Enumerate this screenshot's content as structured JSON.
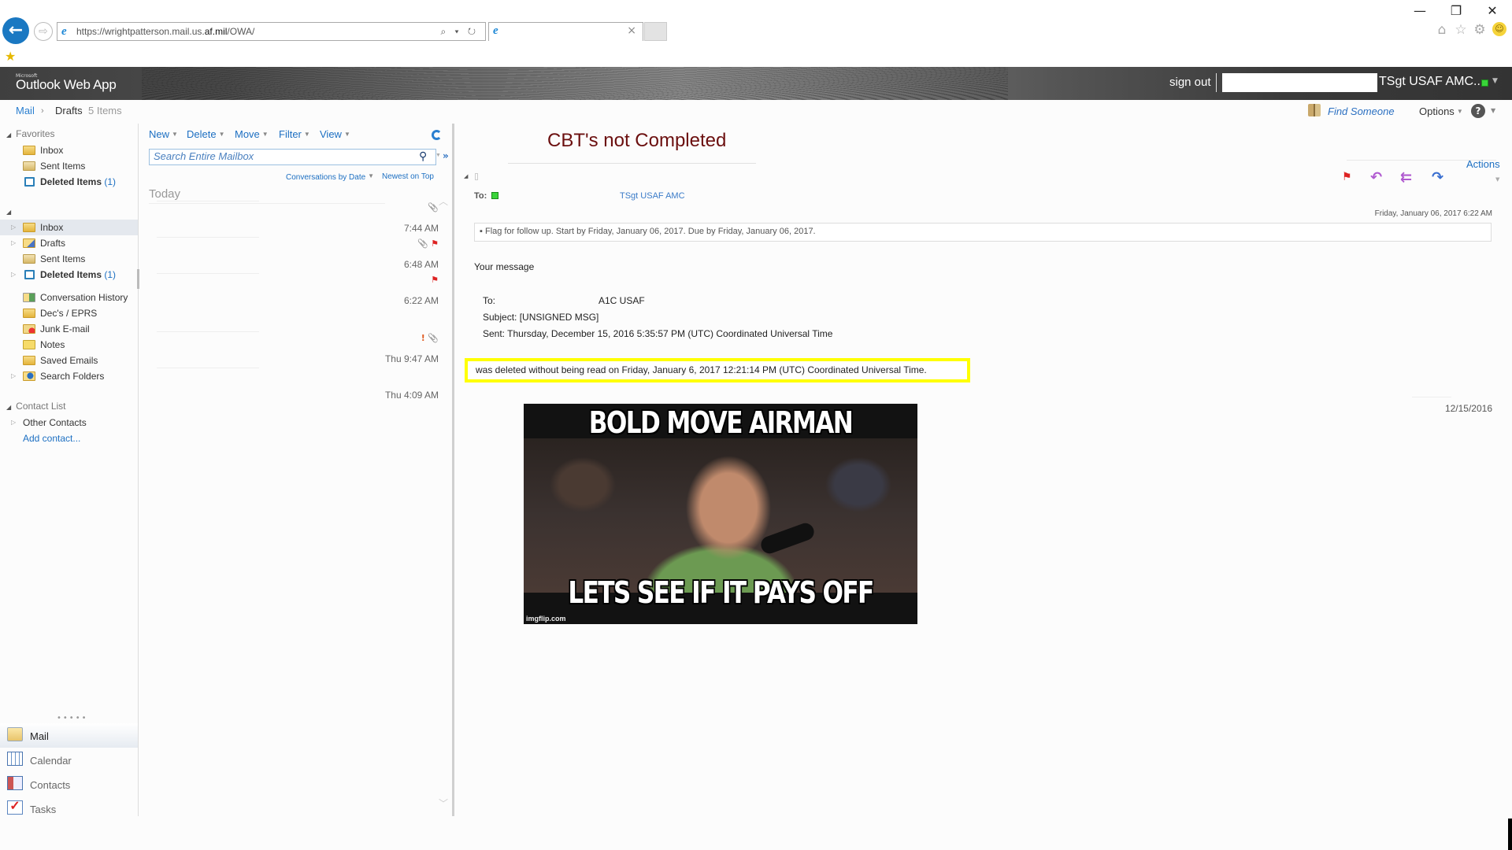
{
  "browser": {
    "url_prefix": "https://wrightpatterson.mail.us.",
    "url_domain": "af.mil",
    "url_suffix": "/OWA/",
    "tab_close": "×",
    "back_glyph": "←",
    "forward_glyph": "⇨",
    "addr_tools": "⌕ ▾ ↻",
    "window_controls": {
      "minimize": "—",
      "restore": "❐",
      "close": "✕"
    },
    "toolbar_icons": {
      "home": "⌂",
      "favorites": "☆",
      "settings": "⚙",
      "feedback": "☺"
    },
    "fav_bar_icon": "★"
  },
  "owa": {
    "brand_small": "Microsoft",
    "brand": "Outlook Web App",
    "sign_out": "sign out",
    "user": "TSgt USAF AMC...",
    "presence_color": "#3ad43a"
  },
  "breadcrumb": {
    "root": "Mail",
    "sep": "›",
    "folder": "Drafts",
    "count": "5 Items"
  },
  "topright": {
    "find_someone": "Find Someone",
    "options": "Options",
    "help": "?"
  },
  "folders": {
    "favorites_label": "Favorites",
    "favorites": [
      {
        "label": "Inbox",
        "icon": "inbox-icon"
      },
      {
        "label": "Sent Items",
        "icon": "sent-items-icon"
      },
      {
        "label": "Deleted Items",
        "count": "(1)",
        "icon": "deleted-items-icon"
      }
    ],
    "mailbox": [
      {
        "label": "Inbox",
        "expandable": true,
        "selected": true
      },
      {
        "label": "Drafts",
        "expandable": true
      },
      {
        "label": "Sent Items",
        "expandable": false
      },
      {
        "label": "Deleted Items",
        "count": "(1)",
        "expandable": true
      },
      {
        "label": "Conversation History"
      },
      {
        "label": "Dec's / EPRS"
      },
      {
        "label": "Junk E-mail"
      },
      {
        "label": "Notes"
      },
      {
        "label": "Saved Emails"
      },
      {
        "label": "Search Folders",
        "expandable": true
      }
    ],
    "contact_list_label": "Contact List",
    "other_contacts": "Other Contacts",
    "add_contact": "Add contact...",
    "grip": "•••••"
  },
  "nav": [
    {
      "label": "Mail",
      "selected": true
    },
    {
      "label": "Calendar"
    },
    {
      "label": "Contacts"
    },
    {
      "label": "Tasks"
    }
  ],
  "list": {
    "toolbar": [
      "New",
      "Delete",
      "Move",
      "Filter",
      "View"
    ],
    "search_placeholder": "Search Entire Mailbox",
    "sort_by": "Conversations by Date",
    "sort_order": "Newest on Top",
    "group_today": "Today",
    "messages": [
      {
        "time": "7:44 AM",
        "attachment": true,
        "flag": false,
        "important": false
      },
      {
        "time": "6:48 AM",
        "attachment": true,
        "flag": true,
        "important": false
      },
      {
        "time": "6:22 AM",
        "attachment": false,
        "flag": true,
        "important": false
      },
      {
        "time": "Thu 9:47 AM",
        "attachment": true,
        "flag": false,
        "important": true
      },
      {
        "time": "Thu 4:09 AM",
        "attachment": false,
        "flag": false,
        "important": false
      }
    ]
  },
  "reading": {
    "subject": "CBT's not Completed",
    "actions": "Actions",
    "to_label": "To:",
    "to_name": "TSgt USAF AMC",
    "received": "Friday, January 06, 2017 6:22 AM",
    "flag_info": "Flag for follow up. Start by Friday, January 06, 2017. Due by Friday, January 06, 2017.",
    "body": {
      "intro": "Your message",
      "to_label": "To:",
      "to_value": "A1C USAF",
      "subject_line": "Subject: [UNSIGNED MSG]",
      "sent_line": "Sent: Thursday, December 15, 2016 5:35:57 PM (UTC) Coordinated Universal Time",
      "deleted_line": "was deleted without being read on Friday, January 6, 2017 12:21:14 PM (UTC) Coordinated Universal Time.",
      "highlight_color": "#ffff00"
    },
    "quoted_date": "12/15/2016",
    "meme": {
      "top_text": "BOLD MOVE AIRMAN",
      "bottom_text": "LETS SEE IF IT PAYS OFF",
      "watermark": "imgflip.com"
    }
  }
}
